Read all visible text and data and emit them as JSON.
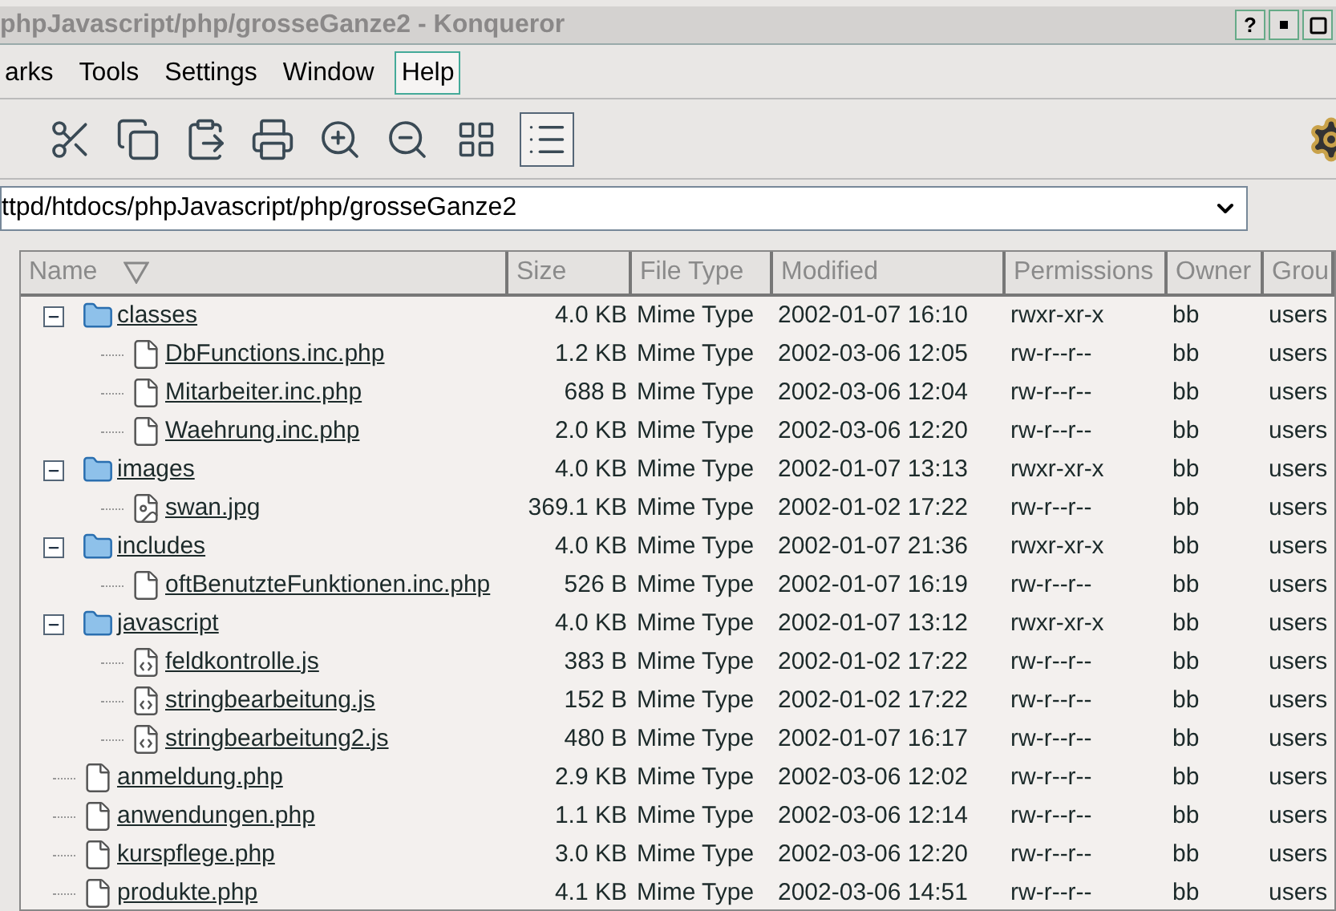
{
  "window": {
    "title": "phpJavascript/php/grosseGanze2 - Konqueror",
    "help_button": "?"
  },
  "menu": [
    {
      "label": "arks",
      "selected": false
    },
    {
      "label": "Tools",
      "selected": false
    },
    {
      "label": "Settings",
      "selected": false
    },
    {
      "label": "Window",
      "selected": false
    },
    {
      "label": "Help",
      "selected": true
    }
  ],
  "toolbar": [
    {
      "kind": "cut"
    },
    {
      "kind": "copy"
    },
    {
      "kind": "paste"
    },
    {
      "kind": "print"
    },
    {
      "kind": "zoom-in"
    },
    {
      "kind": "zoom-out"
    }
  ],
  "view_modes": [
    {
      "kind": "icons",
      "selected": false
    },
    {
      "kind": "details",
      "selected": true
    }
  ],
  "location": {
    "value": "ttpd/htdocs/phpJavascript/php/grosseGanze2"
  },
  "table": {
    "sort_descending": true,
    "columns": [
      {
        "label": "Name"
      },
      {
        "label": "Size"
      },
      {
        "label": "File Type"
      },
      {
        "label": "Modified"
      },
      {
        "label": "Permissions"
      },
      {
        "label": "Owner"
      },
      {
        "label": "Grou"
      }
    ],
    "rows": [
      {
        "kind": "folder",
        "expanded": true,
        "name": "classes",
        "size": "4.0 KB",
        "type": "Mime Type",
        "modified": "2002-01-07 16:10",
        "permissions": "rwxr-xr-x",
        "owner": "bb",
        "group": "users",
        "children": [
          {
            "kind": "file",
            "name": "DbFunctions.inc.php",
            "size": "1.2 KB",
            "type": "Mime Type",
            "modified": "2002-03-06 12:05",
            "permissions": "rw-r--r--",
            "owner": "bb",
            "group": "users"
          },
          {
            "kind": "file",
            "name": "Mitarbeiter.inc.php",
            "size": "688 B",
            "type": "Mime Type",
            "modified": "2002-03-06 12:04",
            "permissions": "rw-r--r--",
            "owner": "bb",
            "group": "users"
          },
          {
            "kind": "file",
            "name": "Waehrung.inc.php",
            "size": "2.0 KB",
            "type": "Mime Type",
            "modified": "2002-03-06 12:20",
            "permissions": "rw-r--r--",
            "owner": "bb",
            "group": "users"
          }
        ]
      },
      {
        "kind": "folder",
        "expanded": true,
        "name": "images",
        "size": "4.0 KB",
        "type": "Mime Type",
        "modified": "2002-01-07 13:13",
        "permissions": "rwxr-xr-x",
        "owner": "bb",
        "group": "users",
        "children": [
          {
            "kind": "image",
            "name": "swan.jpg",
            "size": "369.1 KB",
            "type": "Mime Type",
            "modified": "2002-01-02 17:22",
            "permissions": "rw-r--r--",
            "owner": "bb",
            "group": "users"
          }
        ]
      },
      {
        "kind": "folder",
        "expanded": true,
        "name": "includes",
        "size": "4.0 KB",
        "type": "Mime Type",
        "modified": "2002-01-07 21:36",
        "permissions": "rwxr-xr-x",
        "owner": "bb",
        "group": "users",
        "children": [
          {
            "kind": "file",
            "name": "oftBenutzteFunktionen.inc.php",
            "size": "526 B",
            "type": "Mime Type",
            "modified": "2002-01-07 16:19",
            "permissions": "rw-r--r--",
            "owner": "bb",
            "group": "users"
          }
        ]
      },
      {
        "kind": "folder",
        "expanded": true,
        "name": "javascript",
        "size": "4.0 KB",
        "type": "Mime Type",
        "modified": "2002-01-07 13:12",
        "permissions": "rwxr-xr-x",
        "owner": "bb",
        "group": "users",
        "children": [
          {
            "kind": "script",
            "name": "feldkontrolle.js",
            "size": "383 B",
            "type": "Mime Type",
            "modified": "2002-01-02 17:22",
            "permissions": "rw-r--r--",
            "owner": "bb",
            "group": "users"
          },
          {
            "kind": "script",
            "name": "stringbearbeitung.js",
            "size": "152 B",
            "type": "Mime Type",
            "modified": "2002-01-02 17:22",
            "permissions": "rw-r--r--",
            "owner": "bb",
            "group": "users"
          },
          {
            "kind": "script",
            "name": "stringbearbeitung2.js",
            "size": "480 B",
            "type": "Mime Type",
            "modified": "2002-01-07 16:17",
            "permissions": "rw-r--r--",
            "owner": "bb",
            "group": "users"
          }
        ]
      },
      {
        "kind": "file",
        "name": "anmeldung.php",
        "size": "2.9 KB",
        "type": "Mime Type",
        "modified": "2002-03-06 12:02",
        "permissions": "rw-r--r--",
        "owner": "bb",
        "group": "users"
      },
      {
        "kind": "file",
        "name": "anwendungen.php",
        "size": "1.1 KB",
        "type": "Mime Type",
        "modified": "2002-03-06 12:14",
        "permissions": "rw-r--r--",
        "owner": "bb",
        "group": "users"
      },
      {
        "kind": "file",
        "name": "kurspflege.php",
        "size": "3.0 KB",
        "type": "Mime Type",
        "modified": "2002-03-06 12:20",
        "permissions": "rw-r--r--",
        "owner": "bb",
        "group": "users"
      },
      {
        "kind": "file",
        "name": "produkte.php",
        "size": "4.1 KB",
        "type": "Mime Type",
        "modified": "2002-03-06 14:51",
        "permissions": "rw-r--r--",
        "owner": "bb",
        "group": "users"
      }
    ]
  }
}
